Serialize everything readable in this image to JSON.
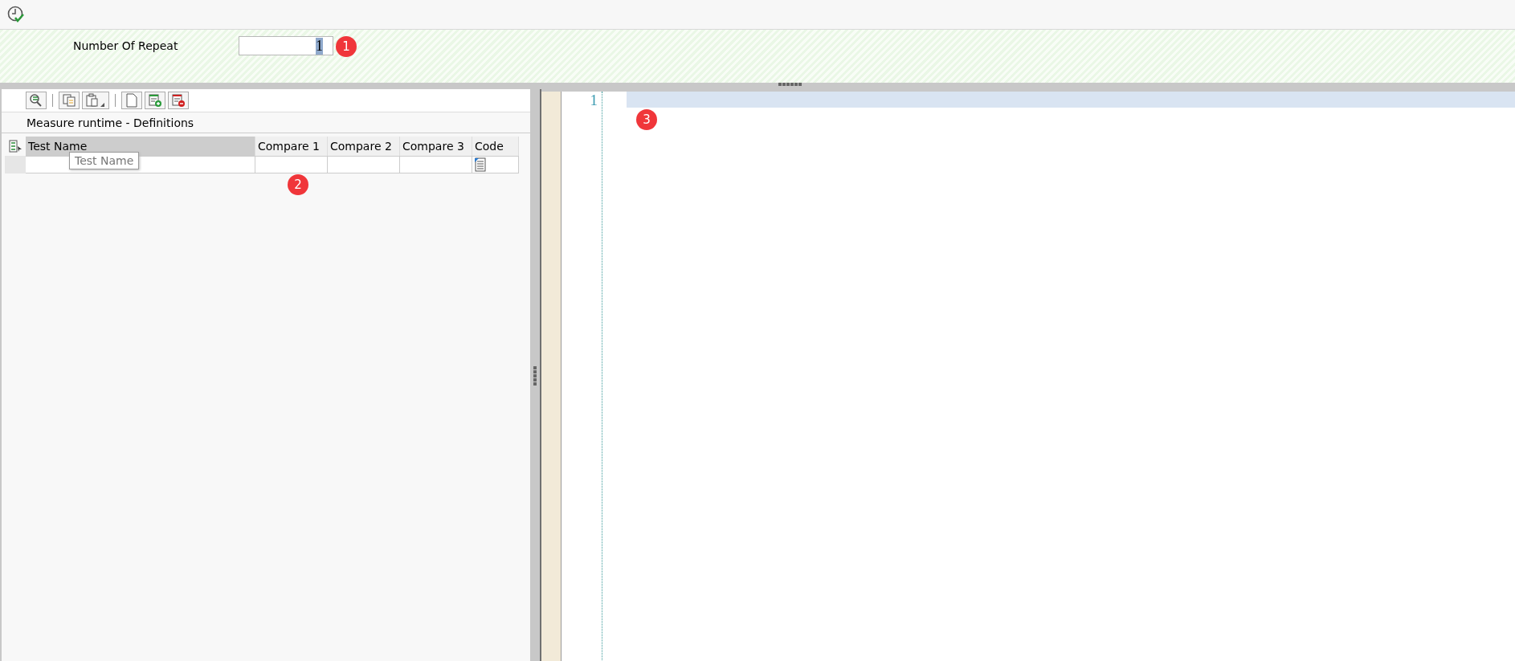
{
  "form": {
    "label": "Number Of Repeat",
    "value": "1",
    "value_selected": true,
    "marker": "1"
  },
  "definitions": {
    "title": "Measure runtime - Definitions",
    "marker": "2",
    "columns": [
      {
        "label": "Test Name",
        "selected": true
      },
      {
        "label": "Compare 1",
        "selected": false
      },
      {
        "label": "Compare 2",
        "selected": false
      },
      {
        "label": "Compare 3",
        "selected": false
      },
      {
        "label": "Code",
        "selected": false
      }
    ],
    "tooltip": "Test Name"
  },
  "editor": {
    "line_numbers": [
      "1"
    ],
    "marker": "3"
  }
}
